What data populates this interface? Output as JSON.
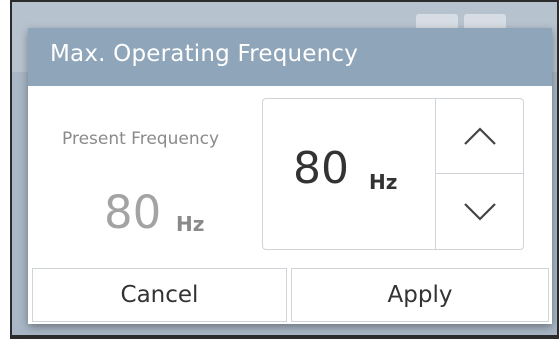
{
  "dialog": {
    "title": "Max. Operating Frequency",
    "present_label": "Present Frequency",
    "present_value": "80",
    "present_unit": "Hz",
    "spinner_value": "80",
    "spinner_unit": "Hz",
    "cancel_label": "Cancel",
    "apply_label": "Apply",
    "up_icon": "chevron-up-icon",
    "down_icon": "chevron-down-icon"
  },
  "colors": {
    "header": "#8fa5ba",
    "background": "#9aa9b9",
    "text_dark": "#333333",
    "text_muted": "#8a8a8a"
  }
}
